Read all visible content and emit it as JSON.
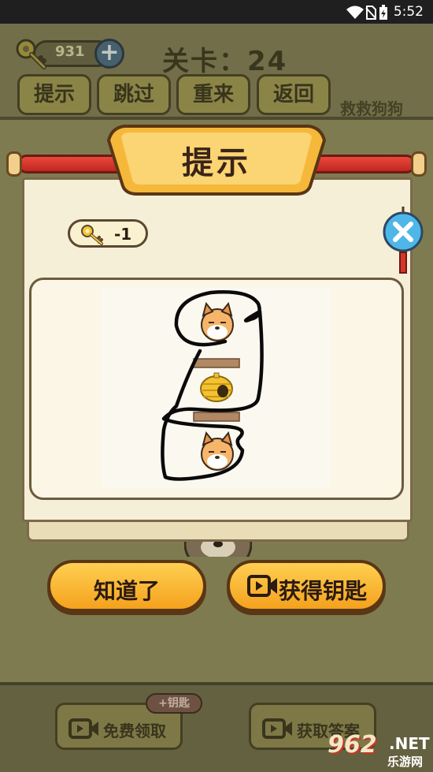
{
  "status_bar": {
    "time": "5:52"
  },
  "header": {
    "key_count": "931",
    "level_label": "关卡：24",
    "buttons": [
      "提示",
      "跳过",
      "重来",
      "返回"
    ],
    "game_title": "救救狗狗"
  },
  "dialog": {
    "title": "提示",
    "key_cost": "-1",
    "ok_label": "知道了",
    "get_key_label": "获得钥匙"
  },
  "bottom": {
    "badge": "+钥匙",
    "free_claim_label": "免费领取",
    "get_answer_label": "获取答案"
  },
  "watermark": {
    "number": "962",
    "domain": ".NET",
    "sub": "乐游网"
  },
  "colors": {
    "accent_yellow": "#f4a21d",
    "scroll_red": "#d6342a",
    "paper": "#f6efd8"
  }
}
